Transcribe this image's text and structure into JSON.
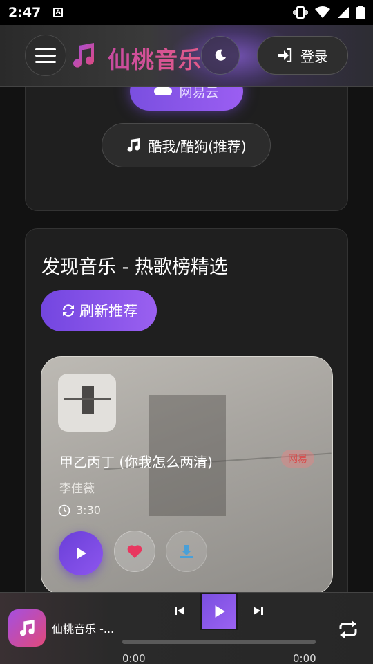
{
  "status_bar": {
    "time": "2:47",
    "notification_letter": "A"
  },
  "header": {
    "app_title": "仙桃音乐",
    "login_label": "登录"
  },
  "sources": {
    "netease_label": "网易云",
    "kuwo_label": "酷我/酷狗(推荐)"
  },
  "discover": {
    "title": "发现音乐 - 热歌榜精选",
    "refresh_label": "刷新推荐",
    "song": {
      "title": "甲乙丙丁 (你我怎么两清)",
      "tag": "网易",
      "artist": "李佳薇",
      "duration": "3:30"
    }
  },
  "player": {
    "title": "仙桃音乐 -...",
    "time_current": "0:00",
    "time_total": "0:00",
    "progress": 0
  },
  "colors": {
    "accent_purple": "#7a4fe0",
    "brand_pink": "#d04a9a",
    "background": "#121212"
  },
  "icons": [
    "menu-icon",
    "music-note-icon",
    "moon-icon",
    "login-icon",
    "refresh-icon",
    "clock-icon",
    "play-icon",
    "heart-icon",
    "download-icon",
    "previous-icon",
    "next-icon",
    "repeat-icon"
  ]
}
